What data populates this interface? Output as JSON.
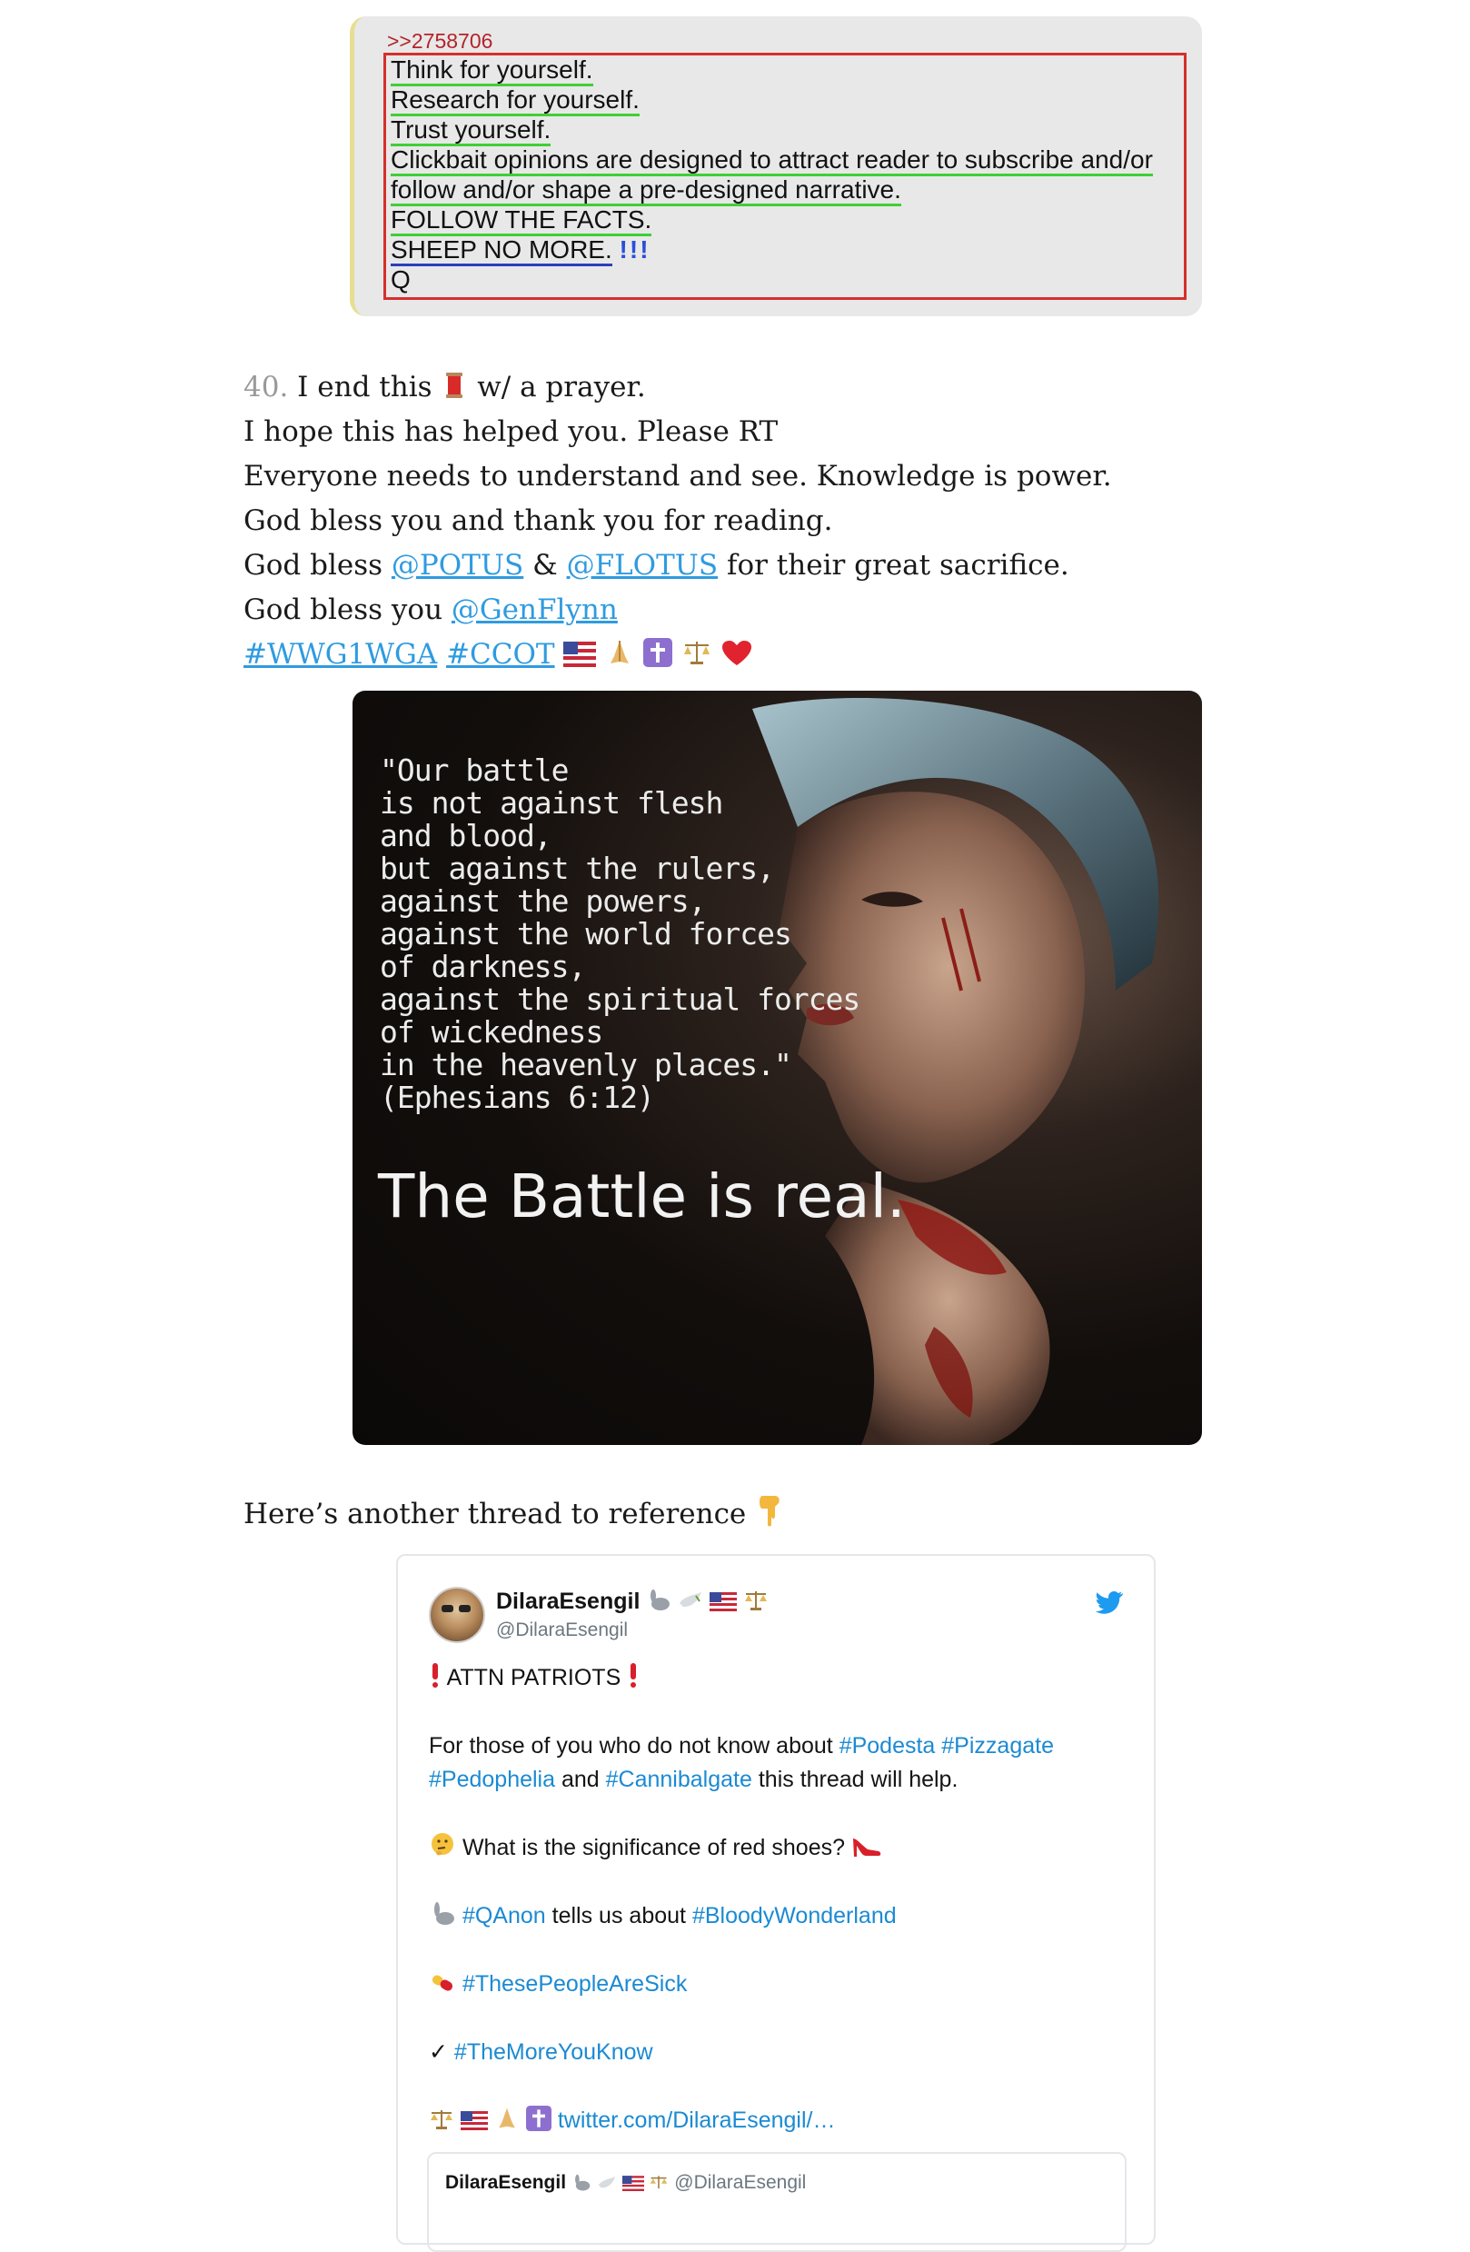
{
  "qpost": {
    "ref": ">>2758706",
    "l1": "Think for yourself.",
    "l2": "Research for yourself.",
    "l3": "Trust yourself.",
    "l4": "Clickbait opinions are designed to attract reader to subscribe and/or",
    "l5": "follow and/or shape a pre-designed narrative.",
    "l6": "FOLLOW THE FACTS.",
    "l7": "SHEEP NO MORE.",
    "l7b": "!!!",
    "l8": "Q"
  },
  "thread": {
    "num": "40.",
    "l1a": "I end this",
    "l1b": "w/ a prayer.",
    "l2": "I hope this has helped you. Please RT",
    "l3": "Everyone needs to understand and see. Knowledge is power.",
    "l4": "God bless you and thank you for reading.",
    "l5a": "God bless",
    "potus": "@POTUS",
    "amp": "&",
    "flotus": "@FLOTUS",
    "l5b": "for their great sacrifice.",
    "l6a": "God bless you",
    "genflynn": "@GenFlynn",
    "tag1": "#WWG1WGA",
    "tag2": "#CCOT"
  },
  "image": {
    "quote": "\"Our battle\nis not against flesh\nand blood,\nbut against the rulers,\nagainst the powers,\nagainst the world forces\nof darkness,\nagainst the spiritual forces\nof wickedness\nin the heavenly places.\"\n(Ephesians 6:12)",
    "big": "The Battle is real."
  },
  "another": "Here’s another thread to reference",
  "tweet": {
    "name": "DilaraEsengil",
    "handle": "@DilaraEsengil",
    "attn": "ATTN PATRIOTS",
    "p2a": "For those of you who do not know about",
    "t_podesta": "#Podesta",
    "t_pizza": "#Pizzagate",
    "t_pedo": "#Pedophelia",
    "and": "and",
    "t_canni": "#Cannibalgate",
    "p2b": "this thread will help.",
    "p3": "What is the significance of red shoes?",
    "t_qanon": "#QAnon",
    "p4": "tells us about",
    "t_bloody": "#BloodyWonderland",
    "t_sick": "#ThesePeopleAreSick",
    "check": "✓",
    "t_more": "#TheMoreYouKnow",
    "link": "twitter.com/DilaraEsengil/…",
    "quoted_name": "DilaraEsengil",
    "quoted_handle": "@DilaraEsengil"
  },
  "colors": {
    "link": "#2f9be0",
    "tag": "#1b8ad3",
    "box": "#d6302b",
    "underline": "#3fcf36"
  }
}
